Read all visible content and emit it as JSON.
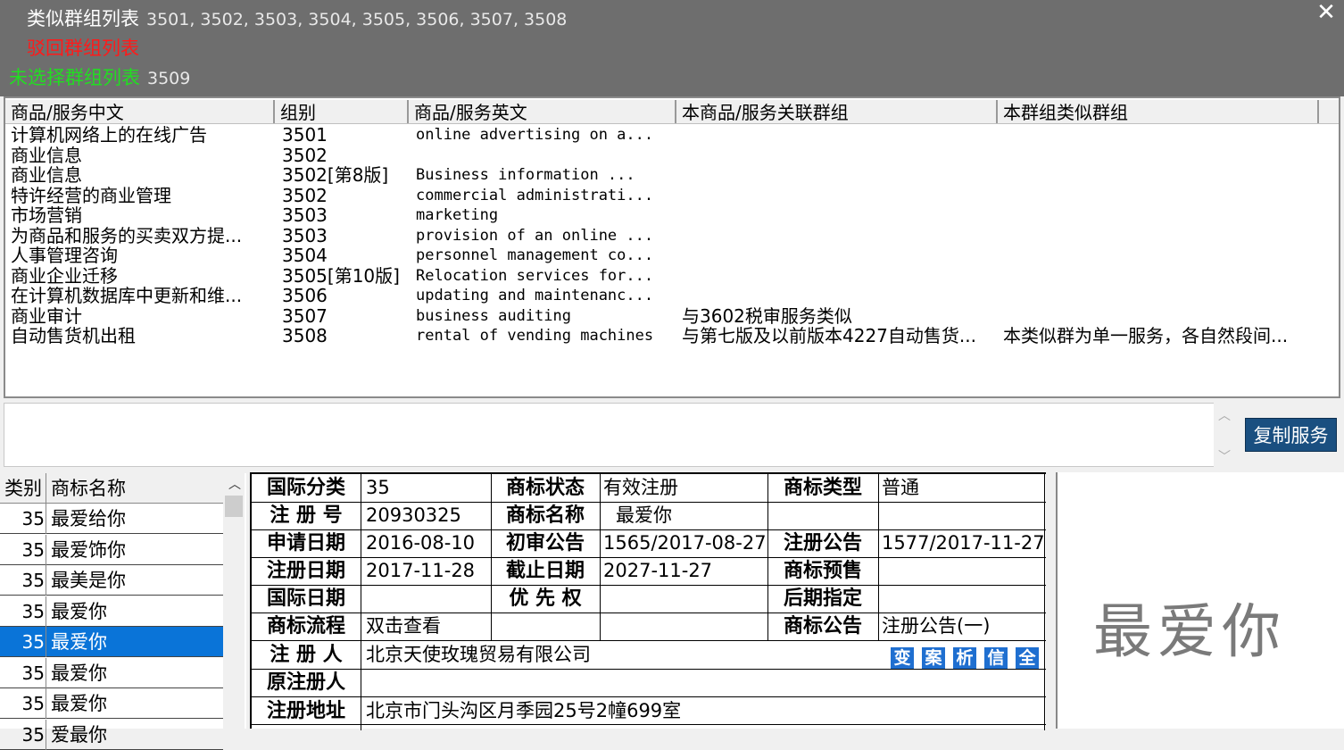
{
  "header": {
    "similar_label": "类似群组列表",
    "similar_value": "3501, 3502, 3503, 3504, 3505, 3506, 3507, 3508",
    "rejected_label": "驳回群组列表",
    "unselected_label": "未选择群组列表",
    "unselected_value": "3509",
    "colors": {
      "similar": "#ffffff",
      "rejected": "#ff1a1a",
      "unselected": "#22dd22"
    }
  },
  "service_table": {
    "columns": [
      "商品/服务中文",
      "组别",
      "商品/服务英文",
      "本商品/服务关联群组",
      "本群组类似群组"
    ],
    "rows": [
      {
        "cn": "计算机网络上的在线广告",
        "group": "3501",
        "en": "online advertising on a...",
        "rel": "",
        "sim": ""
      },
      {
        "cn": "商业信息",
        "group": "3502",
        "en": "",
        "rel": "",
        "sim": ""
      },
      {
        "cn": "商业信息",
        "group": "3502[第8版]",
        "en": "Business information   ...",
        "rel": "",
        "sim": ""
      },
      {
        "cn": "特许经营的商业管理",
        "group": "3502",
        "en": "commercial administrati...",
        "rel": "",
        "sim": ""
      },
      {
        "cn": "市场营销",
        "group": "3503",
        "en": "marketing",
        "rel": "",
        "sim": ""
      },
      {
        "cn": "为商品和服务的买卖双方提...",
        "group": "3503",
        "en": "provision of an online ...",
        "rel": "",
        "sim": ""
      },
      {
        "cn": "人事管理咨询",
        "group": "3504",
        "en": "personnel management co...",
        "rel": "",
        "sim": ""
      },
      {
        "cn": "商业企业迁移",
        "group": "3505[第10版]",
        "en": "Relocation services for...",
        "rel": "",
        "sim": ""
      },
      {
        "cn": "在计算机数据库中更新和维...",
        "group": "3506",
        "en": "updating and maintenanc...",
        "rel": "",
        "sim": ""
      },
      {
        "cn": "商业审计",
        "group": "3507",
        "en": "business auditing",
        "rel": "与3602税审服务类似",
        "sim": ""
      },
      {
        "cn": "自动售货机出租",
        "group": "3508",
        "en": "rental of vending machines",
        "rel": "与第七版及以前版本4227自动售货...",
        "sim": "本类似群为单一服务，各自然段间..."
      }
    ]
  },
  "copy_button": "复制服务",
  "trademark_list": {
    "headers": [
      "类别",
      "商标名称"
    ],
    "rows": [
      {
        "cat": "35",
        "name": "最爱给你"
      },
      {
        "cat": "35",
        "name": "最爱饰你"
      },
      {
        "cat": "35",
        "name": "最美是你"
      },
      {
        "cat": "35",
        "name": "最爱你"
      },
      {
        "cat": "35",
        "name": "最爱你",
        "selected": true
      },
      {
        "cat": "35",
        "name": "最爱你"
      },
      {
        "cat": "35",
        "name": "最爱你"
      },
      {
        "cat": "35",
        "name": "爱最你"
      }
    ]
  },
  "detail": {
    "intl_class_label": "国际分类",
    "intl_class": "35",
    "status_label": "商标状态",
    "status": "有效注册",
    "type_label": "商标类型",
    "type": "普通",
    "reg_no_label": "注 册 号",
    "reg_no": "20930325",
    "name_label": "商标名称",
    "name": "最爱你",
    "apply_date_label": "申请日期",
    "apply_date": "2016-08-10",
    "prelim_label": "初审公告",
    "prelim": "1565/2017-08-27",
    "reg_notice_label": "注册公告",
    "reg_notice": "1577/2017-11-27",
    "reg_date_label": "注册日期",
    "reg_date": "2017-11-28",
    "expiry_label": "截止日期",
    "expiry": "2027-11-27",
    "presale_label": "商标预售",
    "presale": "",
    "intl_date_label": "国际日期",
    "intl_date": "",
    "priority_label": "优 先 权",
    "priority": "",
    "later_label": "后期指定",
    "later": "",
    "flow_label": "商标流程",
    "flow": "双击查看",
    "notice_label": "商标公告",
    "notice": "注册公告(一)",
    "registrant_label": "注 册 人",
    "registrant": "北京天使玫瑰贸易有限公司",
    "orig_registrant_label": "原注册人",
    "orig_registrant": "",
    "address_label": "注册地址",
    "address": "北京市门头沟区月季园25号2幢699室",
    "action_buttons": [
      "变",
      "案",
      "析",
      "信",
      "全"
    ]
  },
  "mark_image_text": "最爱你"
}
